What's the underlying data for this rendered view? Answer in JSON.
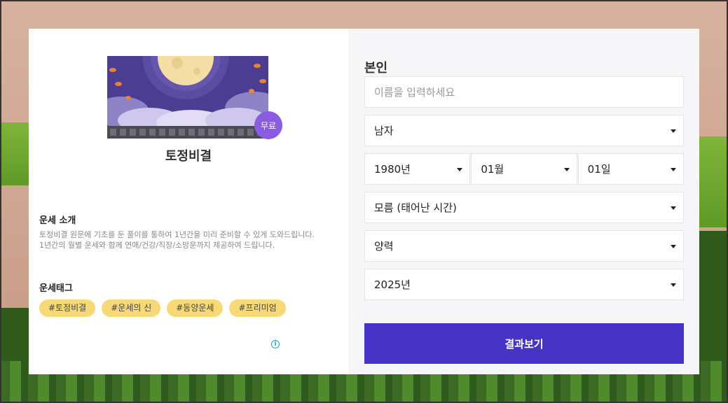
{
  "product": {
    "badge": "무료",
    "title": "토정비결"
  },
  "intro": {
    "heading": "운세 소개",
    "text_line1": "토정비결 원문에 기초를 둔 풀이를 통하여 1년간을 미리 준비할 수 있게 도와드립니다.",
    "text_line2": "1년간의 월별 운세와 함께 연애/건강/직장/소망운까지 제공하여 드립니다."
  },
  "tags_section": {
    "heading": "운세태그",
    "tags": [
      "#토정비결",
      "#운세의 신",
      "#동양운세",
      "#프리미엄"
    ]
  },
  "form": {
    "title": "본인",
    "name_placeholder": "이름을 입력하세요",
    "gender": "남자",
    "year": "1980년",
    "month": "01월",
    "day": "01일",
    "birth_time": "모름 (태어난 시간)",
    "calendar": "양력",
    "target_year": "2025년",
    "submit_label": "결과보기"
  },
  "colors": {
    "accent": "#4633c3",
    "tag_bg": "#f7d978",
    "badge_bg": "#8a5de0"
  },
  "icons": {
    "info": "info-icon",
    "dropdown": "caret-down-icon"
  }
}
